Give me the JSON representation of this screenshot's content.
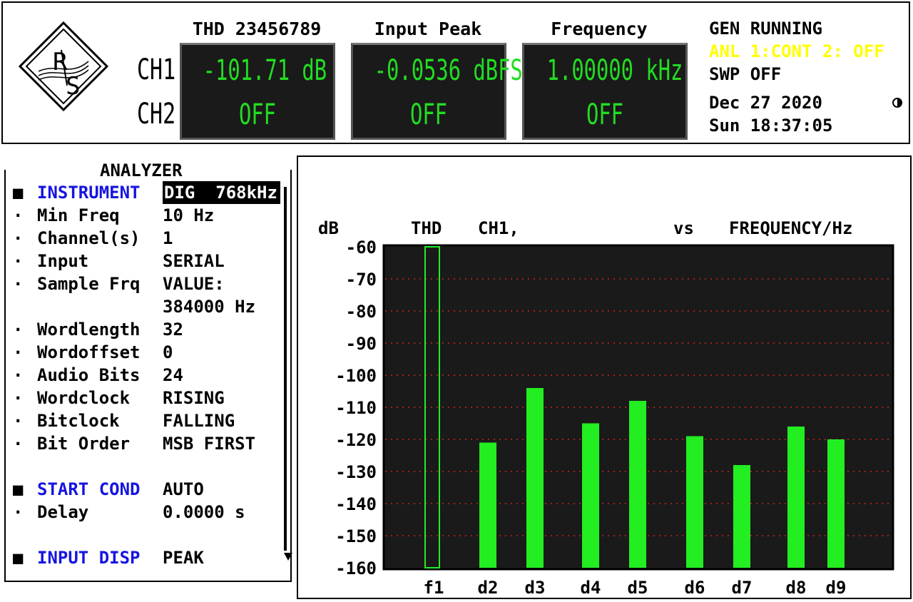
{
  "header": {
    "ch1_label": "CH1",
    "ch2_label": "CH2",
    "displays": [
      {
        "title": "THD 23456789",
        "ch1": "-101.71 dB",
        "ch2": "OFF"
      },
      {
        "title": "Input Peak",
        "ch1": "-0.0536 dBFS",
        "ch2": "OFF"
      },
      {
        "title": "Frequency",
        "ch1": "1.00000 kHz",
        "ch2": "OFF"
      }
    ],
    "status": {
      "gen": "GEN RUNNING",
      "anl": "ANL 1:CONT 2: OFF",
      "swp": "SWP OFF",
      "date": "Dec 27 2020",
      "time": "Sun 18:37:05",
      "anl_color": "#ffff00"
    },
    "logo_letters": "R&S"
  },
  "panel": {
    "title": "ANALYZER",
    "rows": [
      {
        "marker": "■",
        "label": "INSTRUMENT",
        "value": "DIG  768kHz"
      },
      {
        "marker": "·",
        "label": "Min Freq",
        "value": "10 Hz"
      },
      {
        "marker": "·",
        "label": "Channel(s)",
        "value": "1"
      },
      {
        "marker": "·",
        "label": "Input",
        "value": "SERIAL"
      },
      {
        "marker": "·",
        "label": "Sample Frq",
        "value": "VALUE:"
      },
      {
        "marker": "",
        "label": "",
        "value": "384000 Hz"
      },
      {
        "marker": "·",
        "label": "Wordlength",
        "value": "32"
      },
      {
        "marker": "·",
        "label": "Wordoffset",
        "value": "0"
      },
      {
        "marker": "·",
        "label": "Audio Bits",
        "value": "24"
      },
      {
        "marker": "·",
        "label": "Wordclock",
        "value": "RISING"
      },
      {
        "marker": "·",
        "label": "Bitclock",
        "value": "FALLING"
      },
      {
        "marker": "·",
        "label": "Bit Order",
        "value": "MSB FIRST"
      },
      {
        "marker": "■",
        "label": "START COND",
        "value": "AUTO"
      },
      {
        "marker": "·",
        "label": "Delay",
        "value": "0.0000 s"
      },
      {
        "marker": "■",
        "label": "INPUT DISP",
        "value": "PEAK"
      }
    ],
    "head_color": "#1515e0"
  },
  "graph": {
    "ylabel": "dB",
    "series_label": "THD",
    "channel_label": "CH1,",
    "vs_label": "vs",
    "xlabel": "FREQUENCY/Hz"
  },
  "chart_data": {
    "type": "bar",
    "categories": [
      "f1",
      "d2",
      "d3",
      "d4",
      "d5",
      "d6",
      "d7",
      "d8",
      "d9"
    ],
    "values": [
      -60,
      -121,
      -104,
      -115,
      -108,
      -119,
      -128,
      -116,
      -120
    ],
    "fundamental_outline": true,
    "ylabel": "dB",
    "xlabel": "FREQUENCY/Hz",
    "ylim": [
      -160,
      -60
    ],
    "yticks": [
      -60,
      -70,
      -80,
      -90,
      -100,
      -110,
      -120,
      -130,
      -140,
      -150,
      -160
    ],
    "grid": true,
    "bar_color": "#22ee22",
    "plot_bg": "#1a1a1a",
    "grid_color": "#cc2222"
  }
}
